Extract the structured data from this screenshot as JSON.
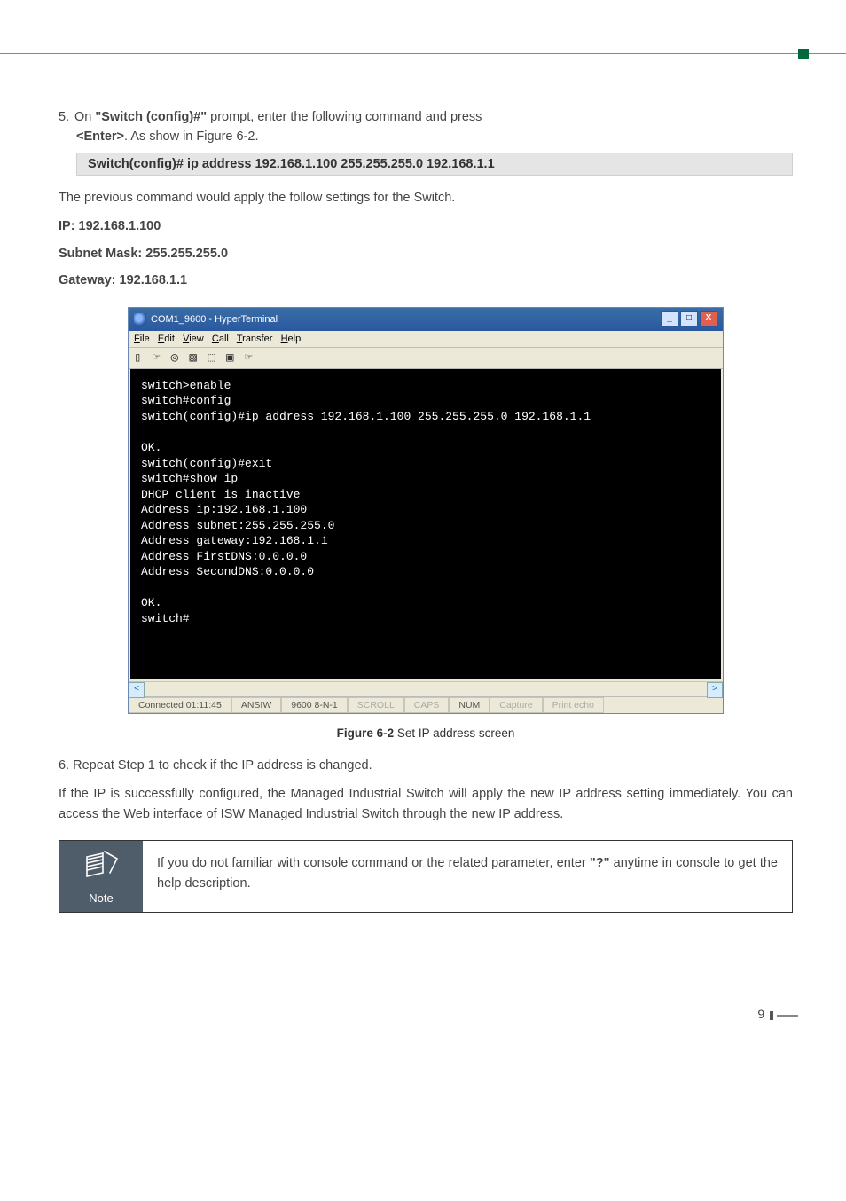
{
  "step5": {
    "number": "5.",
    "text_part1": "On ",
    "prompt": "\"Switch (config)#\"",
    "text_part2": " prompt, enter the following command and press ",
    "enter": "<Enter>",
    "text_part3": ". As show in Figure 6-2."
  },
  "command_bar": "Switch(config)# ip address 192.168.1.100 255.255.255.0 192.168.1.1",
  "prev_cmd_text": "The previous command would apply the follow settings for the Switch.",
  "ip_line": "IP: 192.168.1.100",
  "subnet_line": "Subnet Mask: 255.255.255.0",
  "gateway_line": "Gateway: 192.168.1.1",
  "terminal": {
    "title": "COM1_9600 - HyperTerminal",
    "menu": {
      "file": "File",
      "edit": "Edit",
      "view": "View",
      "call": "Call",
      "transfer": "Transfer",
      "help": "Help"
    },
    "toolbar_glyphs": "▯ ☞  ◎ ▨  ⬚ ▣  ☞",
    "content": "switch>enable\nswitch#config\nswitch(config)#ip address 192.168.1.100 255.255.255.0 192.168.1.1\n\nOK.\nswitch(config)#exit\nswitch#show ip\nDHCP client is inactive\nAddress ip:192.168.1.100\nAddress subnet:255.255.255.0\nAddress gateway:192.168.1.1\nAddress FirstDNS:0.0.0.0\nAddress SecondDNS:0.0.0.0\n\nOK.\nswitch#",
    "status": {
      "connected": "Connected 01:11:45",
      "ansiw": "ANSIW",
      "baud": "9600 8-N-1",
      "scroll": "SCROLL",
      "caps": "CAPS",
      "num": "NUM",
      "capture": "Capture",
      "printecho": "Print echo"
    },
    "winbtns": {
      "min": "_",
      "max": "□",
      "close": "X"
    },
    "arrows": {
      "left": "<",
      "right": ">"
    }
  },
  "figure": {
    "label": "Figure 6-2",
    "caption": "  Set IP address screen"
  },
  "step6": {
    "number": "6.",
    "text": "Repeat Step 1 to check if the IP address is changed."
  },
  "result_paragraph": "If the IP is successfully configured, the Managed Industrial Switch will apply the new IP address setting immediately. You can access the Web interface of ISW Managed Industrial Switch through the new IP address.",
  "note": {
    "label": "Note",
    "text_part1": "If you do not familiar with console command or the related parameter, enter ",
    "q": "\"?\"",
    "text_part2": " anytime in console to get the help description."
  },
  "page_number": "9"
}
